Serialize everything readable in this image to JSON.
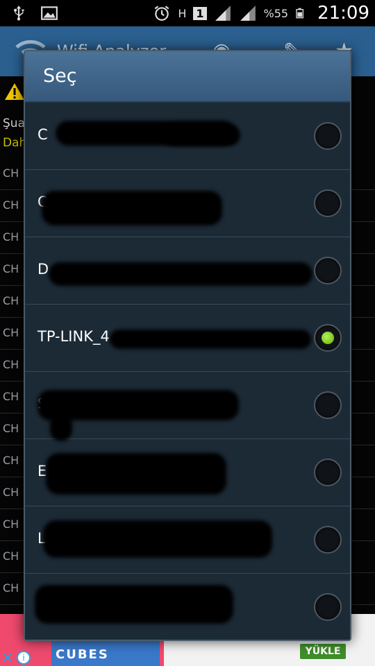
{
  "status_bar": {
    "battery_text": "%55",
    "clock": "21:09",
    "sim_slot": "1",
    "net_type": "H",
    "icons": [
      "usb-icon",
      "image-icon",
      "alarm-icon",
      "network-h-icon",
      "sim-1-icon",
      "signal-icon",
      "signal-icon",
      "battery-icon"
    ]
  },
  "app_bar": {
    "title": "Wifi Analyzer",
    "icons": [
      "wifi-icon",
      "eye-icon",
      "wrench-icon",
      "star-icon"
    ]
  },
  "background_list": {
    "line1": "Şua",
    "line2": "Dah",
    "row_label": "CH",
    "row_count": 14
  },
  "dialog": {
    "title": "Seç",
    "options": [
      {
        "label": "C",
        "checked": false
      },
      {
        "label": "C",
        "checked": false
      },
      {
        "label": "D",
        "checked": false
      },
      {
        "label": "TP-LINK_4",
        "checked": true
      },
      {
        "label": "S",
        "checked": false
      },
      {
        "label": "E",
        "checked": false
      },
      {
        "label": "L",
        "checked": false
      },
      {
        "label": "",
        "checked": false
      }
    ]
  },
  "ad": {
    "game_title": "CUBES",
    "button_label": "YÜKLE",
    "info_label": "i"
  },
  "colors": {
    "accent_radio": "#7fd321",
    "dialog_header": "#4b7398",
    "dialog_body": "#1c2a36",
    "ad_button": "#3f8e2a"
  }
}
